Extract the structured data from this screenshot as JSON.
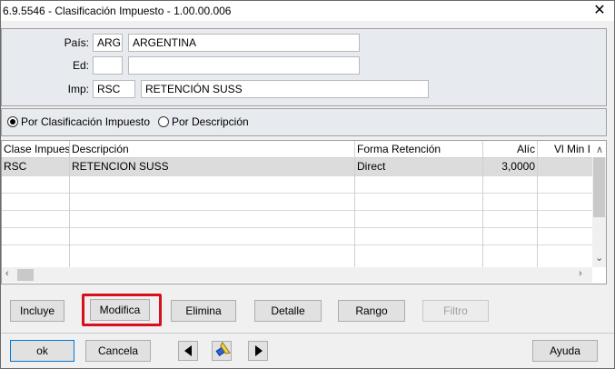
{
  "window": {
    "title": "6.9.5546 - Clasificación Impuesto - 1.00.00.006"
  },
  "form": {
    "pais_label": "País:",
    "pais_code": "ARG",
    "pais_name": "ARGENTINA",
    "ed_label": "Ed:",
    "ed_code": "",
    "ed_name": "",
    "imp_label": "Imp:",
    "imp_code": "RSC",
    "imp_name": "RETENCIÓN SUSS"
  },
  "sort": {
    "option1": "Por Clasificación Impuesto",
    "option2": "Por Descripción",
    "selected": "option1"
  },
  "grid": {
    "columns": [
      "Clase Impuesto",
      "Descripción",
      "Forma Retención",
      "Alíc",
      "Vl Min I"
    ],
    "rows": [
      [
        "RSC",
        "RETENCION SUSS",
        "Direct",
        "3,0000",
        ""
      ]
    ]
  },
  "buttons": {
    "incluye": "Incluye",
    "modifica": "Modifica",
    "elimina": "Elimina",
    "detalle": "Detalle",
    "rango": "Rango",
    "filtro": "Filtro",
    "ok": "ok",
    "cancela": "Cancela",
    "ayuda": "Ayuda"
  },
  "colors": {
    "highlight": "#d6101c"
  },
  "icons": {
    "prev": "triangle-left-icon",
    "search": "flashlight-icon",
    "next": "triangle-right-icon"
  }
}
